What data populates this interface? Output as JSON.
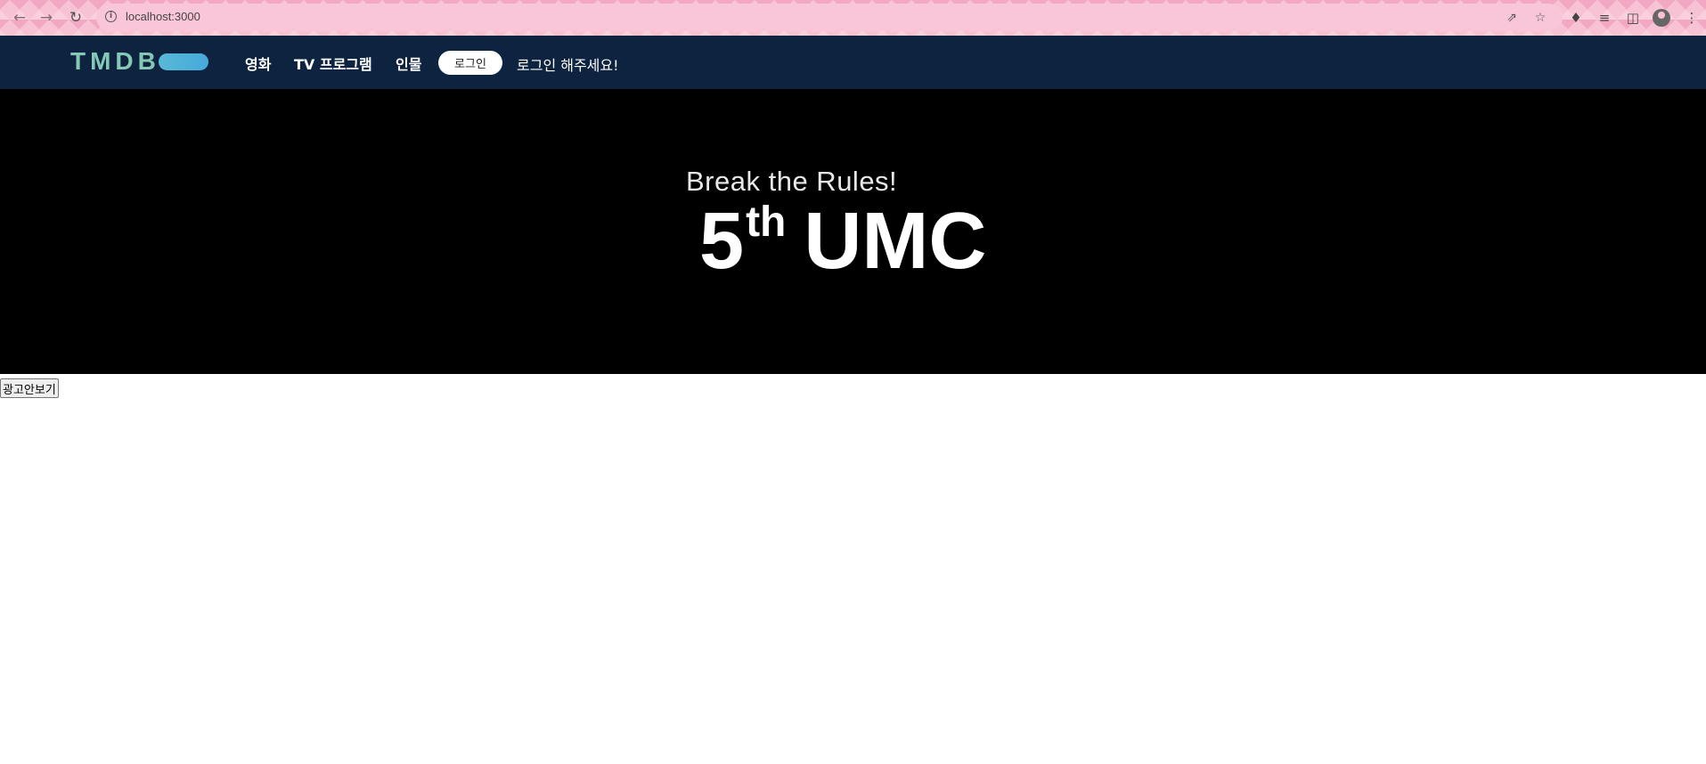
{
  "browser": {
    "url": "localhost:3000",
    "icons": {
      "back": "arrow-left-icon",
      "forward": "arrow-right-icon",
      "reload": "reload-icon",
      "info": "info-icon",
      "share": "share-icon",
      "bookmark": "star-icon",
      "extensions": "puzzle-icon",
      "reading_list": "reading-list-icon",
      "side_panel": "side-panel-icon",
      "profile": "profile-icon",
      "menu": "kebab-menu-icon"
    }
  },
  "header": {
    "logo_text": "TMDB",
    "nav": [
      {
        "label": "영화"
      },
      {
        "label": "TV 프로그램"
      },
      {
        "label": "인물"
      }
    ],
    "login_button": "로그인",
    "login_message": "로그인 해주세요!",
    "colors": {
      "background": "#0d233f",
      "logo": "#84c8b5",
      "logo_pill": "#4fb3da"
    }
  },
  "banner": {
    "tagline": "Break the Rules!",
    "number": "5",
    "superscript": "th",
    "word": "UMC",
    "colors": {
      "background": "#000000",
      "text": "#ffffff"
    }
  },
  "ad_toggle": {
    "label": "광고안보기"
  }
}
